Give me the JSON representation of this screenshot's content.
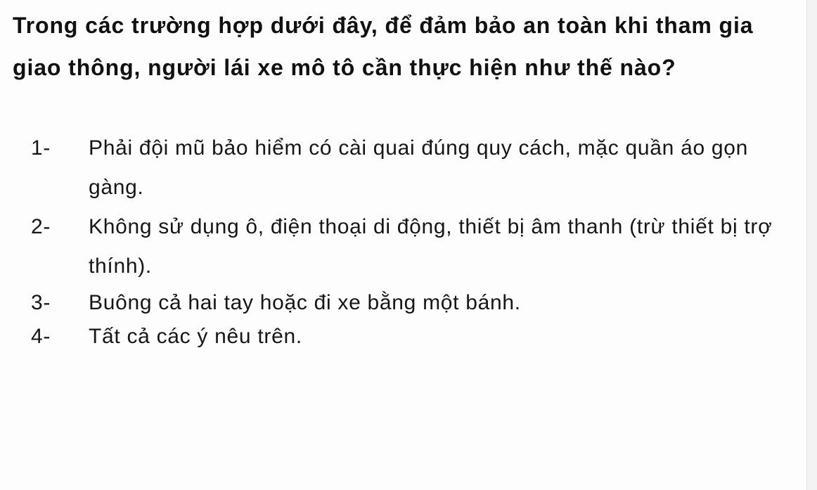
{
  "question": "Trong các trường hợp dưới đây, để đảm bảo an toàn khi tham gia giao thông, người lái xe mô tô cần thực hiện như thế nào?",
  "options": [
    {
      "number": "1-",
      "text": "Phải đội mũ bảo hiểm có cài quai đúng quy cách, mặc quần áo gọn gàng."
    },
    {
      "number": "2-",
      "text": "Không sử dụng ô, điện thoại di động, thiết bị âm thanh (trừ thiết bị trợ thính)."
    },
    {
      "number": "3-",
      "text": "Buông cả hai tay hoặc đi xe bằng một bánh."
    },
    {
      "number": "4-",
      "text": "Tất cả các ý nêu trên."
    }
  ]
}
